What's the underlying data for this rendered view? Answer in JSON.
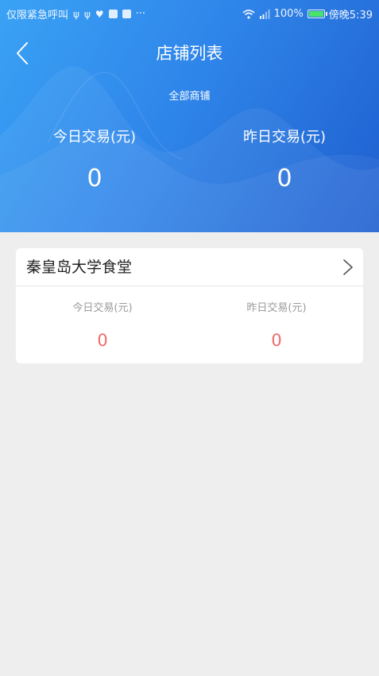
{
  "status_bar": {
    "carrier_text": "仅限紧急呼叫",
    "battery_percent": "100%",
    "time": "傍晚5:39",
    "overflow": "···"
  },
  "header": {
    "title": "店铺列表",
    "scope_label": "全部商铺",
    "today_label": "今日交易(元)",
    "today_value": "0",
    "yesterday_label": "昨日交易(元)",
    "yesterday_value": "0"
  },
  "stores": [
    {
      "name": "秦皇岛大学食堂",
      "today_label": "今日交易(元)",
      "today_value": "0",
      "yesterday_label": "昨日交易(元)",
      "yesterday_value": "0"
    }
  ],
  "colors": {
    "header_start": "#3aa2f5",
    "header_end": "#1f5fcf",
    "value_red": "#f06b6b",
    "background": "#eeeeee"
  },
  "icons": {
    "back": "back-arrow-icon",
    "chevron": "chevron-right-icon",
    "wifi": "wifi-icon",
    "signal": "signal-icon",
    "battery": "battery-icon",
    "usb": "usb-icon",
    "heart": "heart-icon",
    "app": "app-icon"
  }
}
